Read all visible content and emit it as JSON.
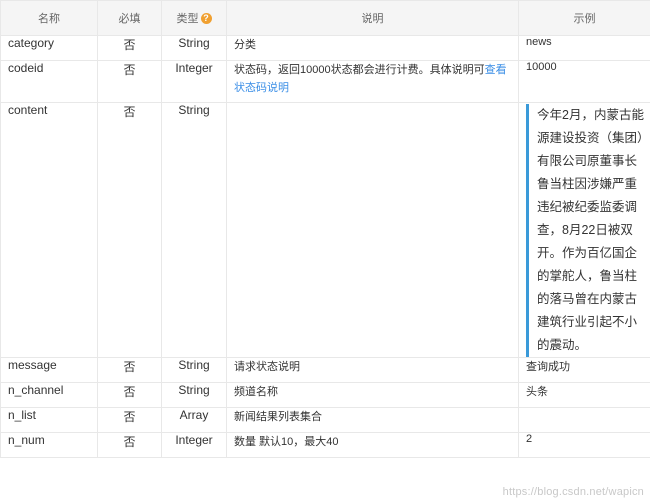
{
  "table": {
    "headers": {
      "name": "名称",
      "required": "必填",
      "type": "类型",
      "description": "说明",
      "example": "示例"
    },
    "type_help_icon": "question-circle-icon",
    "rows": [
      {
        "name": "category",
        "required": "否",
        "type": "String",
        "description": "分类",
        "example": "news"
      },
      {
        "name": "codeid",
        "required": "否",
        "type": "Integer",
        "description": "状态码，返回10000状态都会进行计费。具体说明可",
        "description_link": "查看状态码说明",
        "example": "10000"
      },
      {
        "name": "content",
        "required": "否",
        "type": "String",
        "description": "",
        "example": "今年2月，内蒙古能源建设投资（集团）有限公司原董事长鲁当柱因涉嫌严重违纪被纪委监委调查，8月22日被双开。作为百亿国企的掌舵人，鲁当柱的落马曾在内蒙古建筑行业引起不小的震动。"
      },
      {
        "name": "message",
        "required": "否",
        "type": "String",
        "description": "请求状态说明",
        "example": "查询成功"
      },
      {
        "name": "n_channel",
        "required": "否",
        "type": "String",
        "description": "频道名称",
        "example": "头条"
      },
      {
        "name": "n_list",
        "required": "否",
        "type": "Array",
        "description": "新闻结果列表集合",
        "example": ""
      },
      {
        "name": "n_num",
        "required": "否",
        "type": "Integer",
        "description": "数量 默认10，最大40",
        "example": "2"
      }
    ]
  },
  "colors": {
    "header_bg": "#f5f5f5",
    "border": "#e8e8e8",
    "link": "#3a8ee6",
    "quote_bar": "#3a9ad9",
    "help_icon": "#f0a030"
  },
  "watermark": "https://blog.csdn.net/wapicn"
}
